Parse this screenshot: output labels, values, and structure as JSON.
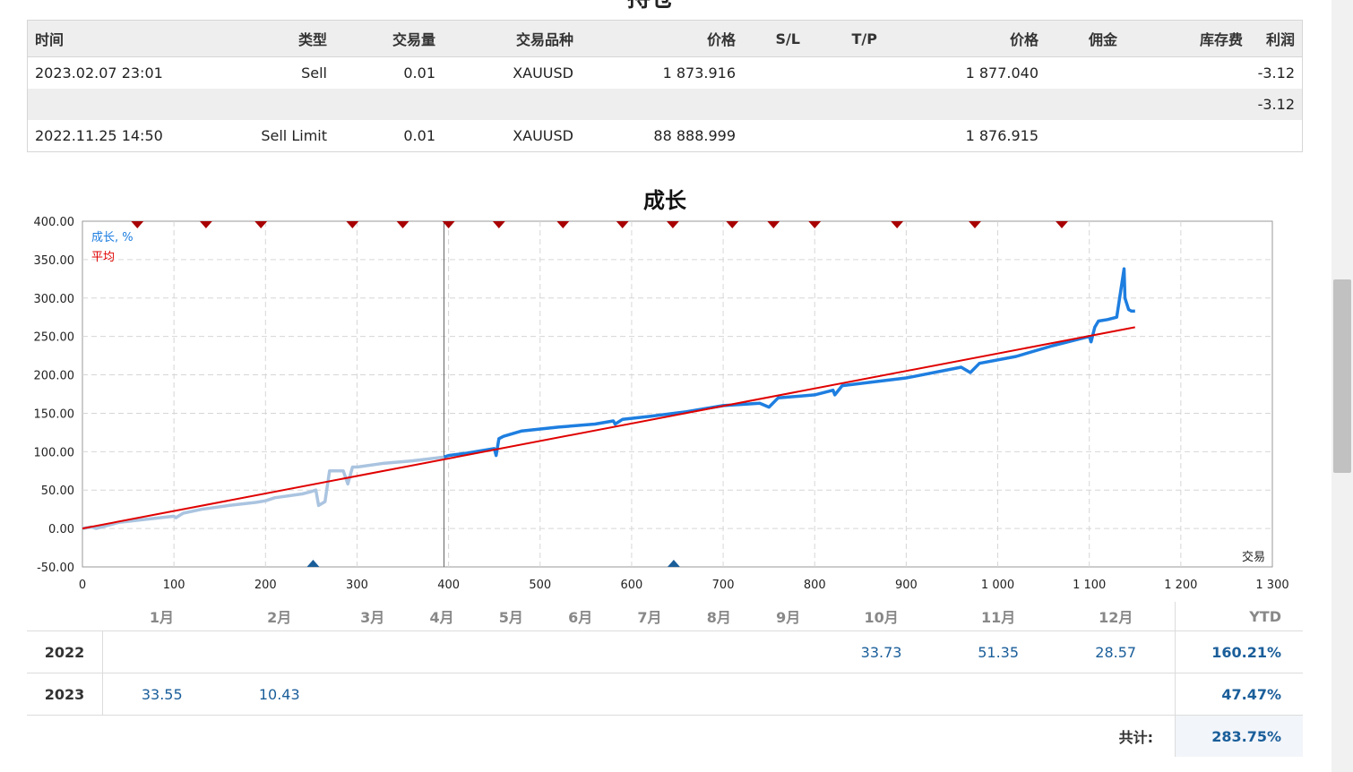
{
  "top_heading": "持仓",
  "orders": {
    "headers": [
      "时间",
      "类型",
      "交易量",
      "交易品种",
      "价格",
      "S/L",
      "T/P",
      "价格",
      "佣金",
      "库存费",
      "利润"
    ],
    "rows": [
      {
        "time": "2023.02.07 23:01",
        "type": "Sell",
        "volume": "0.01",
        "symbol": "XAUUSD",
        "price": "1 873.916",
        "sl": "",
        "tp": "",
        "price2": "1 877.040",
        "commission": "",
        "swap": "",
        "profit": "-3.12"
      },
      {
        "time": "",
        "type": "",
        "volume": "",
        "symbol": "",
        "price": "",
        "sl": "",
        "tp": "",
        "price2": "",
        "commission": "",
        "swap": "",
        "profit": "-3.12"
      },
      {
        "time": "2022.11.25 14:50",
        "type": "Sell Limit",
        "volume": "0.01",
        "symbol": "XAUUSD",
        "price": "88 888.999",
        "sl": "",
        "tp": "",
        "price2": "1 876.915",
        "commission": "",
        "swap": "",
        "profit": ""
      }
    ]
  },
  "chart_data": {
    "type": "line",
    "title": "成长",
    "xlabel": "交易",
    "legend": [
      "成长, %",
      "平均"
    ],
    "colors": {
      "growth": "#1e7ee0",
      "growth_past": "#aac4e0",
      "average": "#e00000",
      "marker_red": "#a80000",
      "marker_blue": "#1a5e9a"
    },
    "xlim": [
      0,
      1300
    ],
    "ylim": [
      -50,
      400
    ],
    "x_ticks": [
      "0",
      "100",
      "200",
      "300",
      "400",
      "500",
      "600",
      "700",
      "800",
      "900",
      "1 000",
      "1 100",
      "1 200",
      "1 300"
    ],
    "y_ticks": [
      "-50.00",
      "0.00",
      "50.00",
      "100.00",
      "150.00",
      "200.00",
      "250.00",
      "300.00",
      "350.00",
      "400.00"
    ],
    "series": [
      {
        "name": "成长, %",
        "x": [
          0,
          10,
          15,
          40,
          70,
          100,
          102,
          110,
          130,
          160,
          190,
          200,
          210,
          240,
          250,
          255,
          258,
          265,
          270,
          285,
          290,
          295,
          300,
          330,
          360,
          395,
          400,
          420,
          450,
          452,
          455,
          460,
          480,
          520,
          560,
          580,
          582,
          590,
          620,
          660,
          700,
          740,
          750,
          760,
          800,
          820,
          822,
          830,
          900,
          960,
          970,
          980,
          1020,
          1060,
          1100,
          1102,
          1106,
          1110,
          1120,
          1130,
          1138,
          1139,
          1143,
          1146,
          1150
        ],
        "y": [
          0,
          2,
          0,
          8,
          12,
          16,
          14,
          20,
          25,
          30,
          34,
          36,
          40,
          45,
          48,
          50,
          30,
          35,
          75,
          75,
          58,
          80,
          80,
          85,
          88,
          93,
          95,
          98,
          104,
          95,
          117,
          120,
          127,
          132,
          136,
          140,
          136,
          142,
          146,
          152,
          160,
          163,
          158,
          170,
          174,
          180,
          174,
          186,
          196,
          210,
          203,
          215,
          224,
          238,
          250,
          243,
          262,
          270,
          272,
          275,
          338,
          300,
          285,
          283,
          283
        ]
      },
      {
        "name": "平均",
        "x": [
          0,
          1150
        ],
        "y": [
          0,
          262
        ]
      }
    ],
    "red_markers_x": [
      60,
      135,
      195,
      295,
      350,
      400,
      455,
      525,
      590,
      645,
      710,
      755,
      800,
      890,
      975,
      1070
    ],
    "blue_markers_x": [
      252,
      646
    ],
    "divider_x": 395
  },
  "monthly": {
    "months": [
      "1月",
      "2月",
      "3月",
      "4月",
      "5月",
      "6月",
      "7月",
      "8月",
      "9月",
      "10月",
      "11月",
      "12月"
    ],
    "ytd_label": "YTD",
    "rows": [
      {
        "year": "2022",
        "values": [
          "",
          "",
          "",
          "",
          "",
          "",
          "",
          "",
          "",
          "33.73",
          "51.35",
          "28.57"
        ],
        "ytd": "160.21%"
      },
      {
        "year": "2023",
        "values": [
          "33.55",
          "10.43",
          "",
          "",
          "",
          "",
          "",
          "",
          "",
          "",
          "",
          ""
        ],
        "ytd": "47.47%"
      }
    ],
    "total_label": "共计:",
    "total_value": "283.75%"
  }
}
